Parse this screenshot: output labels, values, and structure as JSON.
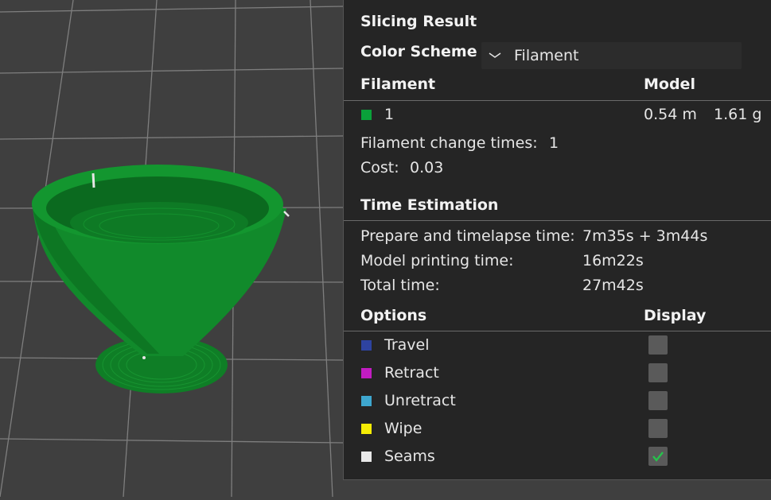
{
  "panel": {
    "title": "Slicing Result",
    "color_scheme": {
      "label": "Color Scheme",
      "value": "Filament"
    },
    "filament_section": {
      "col_filament": "Filament",
      "col_model": "Model",
      "rows": [
        {
          "id": "1",
          "color": "#0aa13a",
          "length": "0.54 m",
          "weight": "1.61 g"
        }
      ],
      "change_times_label": "Filament change times:",
      "change_times_value": "1",
      "cost_label": "Cost:",
      "cost_value": "0.03"
    },
    "time_estimation": {
      "title": "Time Estimation",
      "prepare_label": "Prepare and timelapse time:",
      "prepare_value": "7m35s + 3m44s",
      "model_label": "Model printing time:",
      "model_value": "16m22s",
      "total_label": "Total time:",
      "total_value": "27m42s"
    },
    "options": {
      "col_options": "Options",
      "col_display": "Display",
      "items": [
        {
          "label": "Travel",
          "color": "#2e43a0",
          "checked": false
        },
        {
          "label": "Retract",
          "color": "#c21cc2",
          "checked": false
        },
        {
          "label": "Unretract",
          "color": "#3ea7cf",
          "checked": false
        },
        {
          "label": "Wipe",
          "color": "#f5ec05",
          "checked": false
        },
        {
          "label": "Seams",
          "color": "#e8e8e8",
          "checked": true
        }
      ]
    }
  },
  "colors": {
    "model_green": "#138a2c",
    "viewport_bg": "#3f3f3f",
    "panel_bg": "#242424",
    "check_accent": "#27c24c"
  }
}
